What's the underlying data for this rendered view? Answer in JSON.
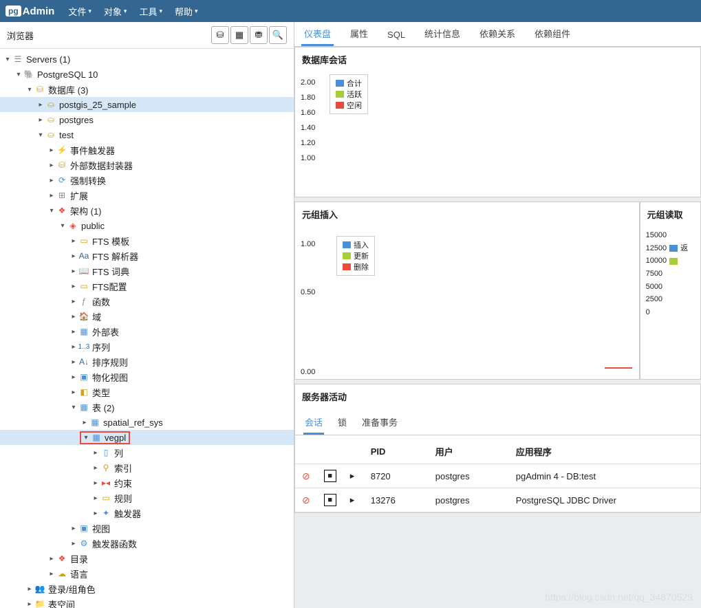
{
  "logo": {
    "prefix": "pg",
    "suffix": "Admin"
  },
  "menu": [
    "文件",
    "对象",
    "工具",
    "帮助"
  ],
  "sidebar": {
    "title": "浏览器"
  },
  "tree": {
    "servers": "Servers (1)",
    "pg10": "PostgreSQL 10",
    "databases": "数据库 (3)",
    "db1": "postgis_25_sample",
    "db2": "postgres",
    "db3": "test",
    "evtrig": "事件触发器",
    "fdw": "外部数据封装器",
    "cast": "强制转换",
    "ext": "扩展",
    "schemas": "架构 (1)",
    "public": "public",
    "fts_tmpl": "FTS 模板",
    "fts_parser": "FTS 解析器",
    "fts_dict": "FTS 词典",
    "fts_conf": "FTS配置",
    "func": "函数",
    "domain": "域",
    "foreign": "外部表",
    "seq": "序列",
    "coll": "排序规则",
    "matview": "物化视图",
    "type": "类型",
    "tables": "表 (2)",
    "t1": "spatial_ref_sys",
    "t2": "vegpl",
    "cols": "列",
    "idx": "索引",
    "con": "约束",
    "rule": "规则",
    "trig": "触发器",
    "view": "视图",
    "trigfunc": "触发器函数",
    "catalog": "目录",
    "lang": "语言",
    "login": "登录/组角色",
    "ts": "表空间"
  },
  "tabs": [
    "仪表盘",
    "属性",
    "SQL",
    "统计信息",
    "依赖关系",
    "依赖组件"
  ],
  "panel_sessions": "数据库会话",
  "panel_tuples_in": "元组插入",
  "panel_tuples_out": "元组读取",
  "panel_activity": "服务器活动",
  "legend_sessions": [
    "合计",
    "活跃",
    "空闲"
  ],
  "legend_tuples": [
    "插入",
    "更新",
    "删除"
  ],
  "legend_out": "返",
  "y_sessions": [
    "2.00",
    "1.80",
    "1.60",
    "1.40",
    "1.20",
    "1.00"
  ],
  "y_tuples": [
    "1.00",
    "0.50",
    "0.00"
  ],
  "y_out": [
    "15000",
    "12500",
    "10000",
    "7500",
    "5000",
    "2500",
    "0"
  ],
  "activity_tabs": [
    "会话",
    "锁",
    "准备事务"
  ],
  "table": {
    "headers": [
      "PID",
      "用户",
      "应用程序"
    ],
    "rows": [
      {
        "pid": "8720",
        "user": "postgres",
        "app": "pgAdmin 4 - DB:test"
      },
      {
        "pid": "13276",
        "user": "postgres",
        "app": "PostgreSQL JDBC Driver"
      }
    ]
  },
  "chart_data": [
    {
      "type": "line",
      "title": "数据库会话",
      "ylim": [
        1.0,
        2.0
      ],
      "series": [
        {
          "name": "合计",
          "values": []
        },
        {
          "name": "活跃",
          "values": []
        },
        {
          "name": "空闲",
          "values": []
        }
      ]
    },
    {
      "type": "line",
      "title": "元组插入",
      "ylim": [
        0.0,
        1.0
      ],
      "series": [
        {
          "name": "插入",
          "values": []
        },
        {
          "name": "更新",
          "values": []
        },
        {
          "name": "删除",
          "values": []
        }
      ]
    },
    {
      "type": "line",
      "title": "元组读取",
      "ylim": [
        0,
        15000
      ],
      "series": [
        {
          "name": "返回",
          "values": []
        }
      ]
    }
  ],
  "colors": {
    "blue": "#4a90d9",
    "green": "#a6ce39",
    "red": "#e74c3c"
  },
  "watermark": "https://blog.csdn.net/qq_34870529"
}
